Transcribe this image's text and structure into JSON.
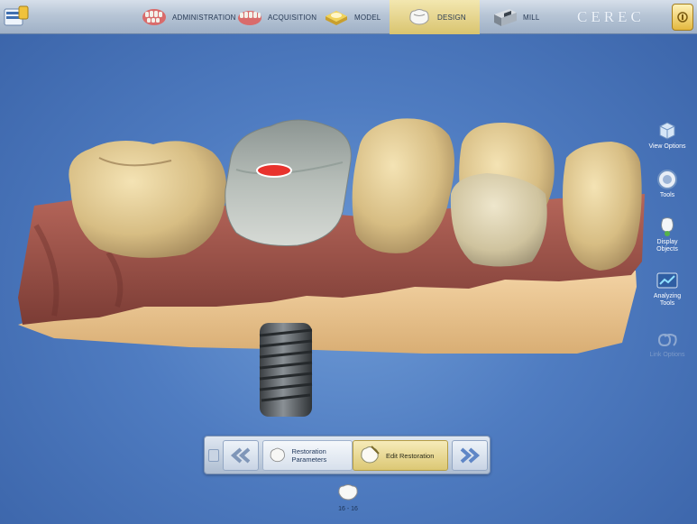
{
  "header": {
    "brand": "CEREC",
    "steps": [
      {
        "label": "ADMINISTRATION",
        "icon": "administration-teeth-icon"
      },
      {
        "label": "ACQUISITION",
        "icon": "acquisition-teeth-icon"
      },
      {
        "label": "MODEL",
        "icon": "model-icon"
      },
      {
        "label": "DESIGN",
        "icon": "design-crown-icon",
        "active": true
      },
      {
        "label": "MILL",
        "icon": "milling-unit-icon"
      }
    ],
    "active_color": "#e3d184"
  },
  "sidebar": {
    "items": [
      {
        "label": "View Options",
        "icon": "view-options-cube-icon",
        "enabled": true
      },
      {
        "label": "Tools",
        "icon": "tools-wheel-icon",
        "enabled": true
      },
      {
        "label": "Display Objects",
        "icon": "display-objects-icon",
        "enabled": true
      },
      {
        "label": "Analyzing Tools",
        "icon": "analyzing-tools-icon",
        "enabled": true
      },
      {
        "label": "Link Options",
        "icon": "link-options-icon",
        "enabled": false
      }
    ]
  },
  "phase_nav": {
    "back_icon": "double-chevron-left-icon",
    "forward_icon": "double-chevron-right-icon",
    "steps": [
      {
        "label": "Restoration Parameters",
        "icon": "restoration-parameters-icon"
      },
      {
        "label": "Edit Restoration",
        "icon": "edit-restoration-icon",
        "active": true
      }
    ]
  },
  "tooth_selector": {
    "label": "16 - 16",
    "icon": "molar-tooth-icon"
  },
  "scene": {
    "gingiva_color": "#9b5448",
    "base_color": "#e9c593",
    "crown_color": "#a9b1ad",
    "implant_color": "#5a5f63",
    "marker_color": "#e8322d"
  }
}
